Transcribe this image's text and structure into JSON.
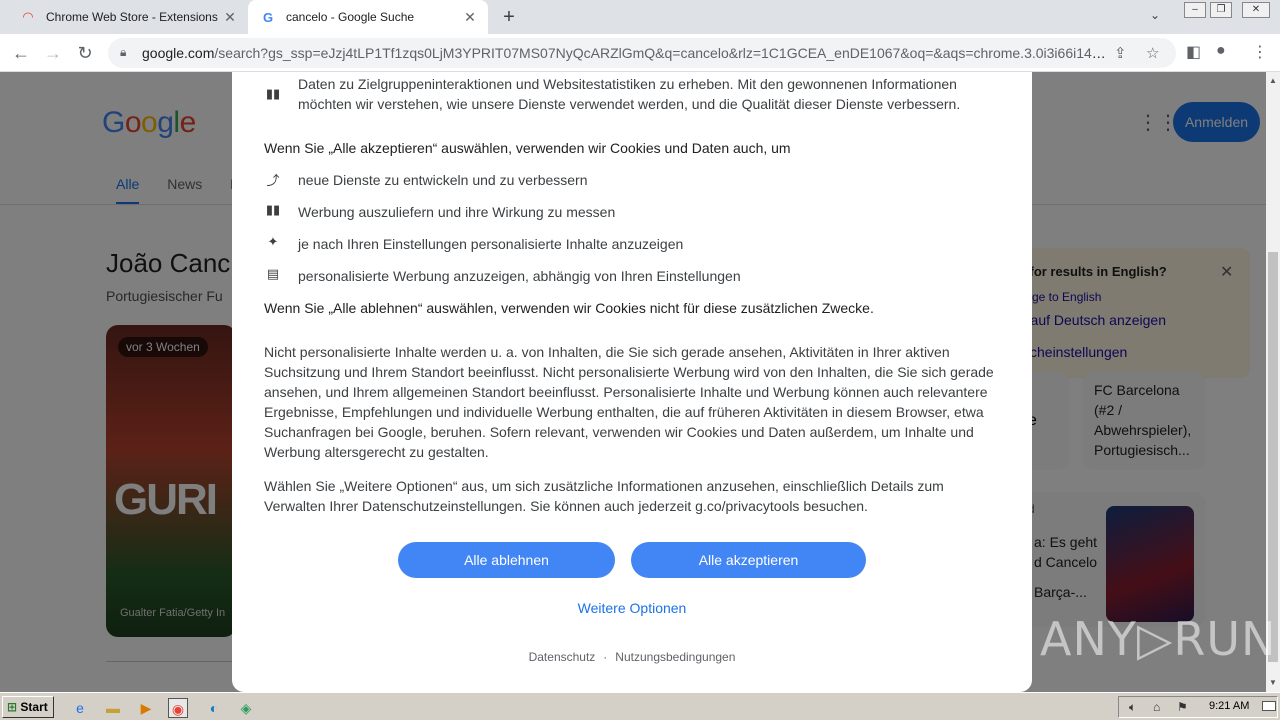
{
  "browser": {
    "tabs": [
      {
        "title": "Chrome Web Store - Extensions",
        "icon": "chrome-web-store-icon",
        "active": false
      },
      {
        "title": "cancelo - Google Suche",
        "icon": "google-g-icon",
        "active": true
      }
    ],
    "address": {
      "host": "google.com",
      "path": "/search?gs_ssp=eJzj4tLP1Tf1zqs0LjM3YPRIT07MS07NyQcARZlGmQ&q=cancelo&rlz=1C1GCEA_enDE1067&oq=&aqs=chrome.3.0i3i66i143i362..."
    }
  },
  "google_page": {
    "logo_letters": [
      "G",
      "o",
      "o",
      "g",
      "l",
      "e"
    ],
    "signin_label": "Anmelden",
    "tabs": [
      "Alle",
      "News",
      "Bi"
    ],
    "kp_title": "João Canc",
    "kp_subtitle": "Portugiesischer Fu",
    "hero_badge": "vor 3 Wochen",
    "hero_credit": "Gualter Fatia/Getty In",
    "hero_banner": "GURI",
    "english_box": {
      "question": "ng for results in English?",
      "link1": "ge to English",
      "link2": "r auf Deutsch anzeigen",
      "link3": "cheinstellungen"
    },
    "card0_text": "e",
    "card1_lines": [
      "FC Barcelona",
      "(#2 /",
      "Abwehrspieler),",
      "Portugiesisch..."
    ],
    "news_lines": [
      "a: Es geht",
      "d Cancelo",
      "Barça-..."
    ],
    "news_date": "d",
    "news_source": "n"
  },
  "consent": {
    "top_line1": "Daten zu Zielgruppeninteraktionen und Websitestatistiken zu erheben. Mit den gewonnenen Informationen",
    "top_line2": "möchten wir verstehen, wie unsere Dienste verwendet werden, und die Qualität dieser Dienste verbessern.",
    "accept_heading": "Wenn Sie „Alle akzeptieren“ auswählen, verwenden wir Cookies und Daten auch, um",
    "accept_items": [
      {
        "icon": "trending-icon",
        "text": "neue Dienste zu entwickeln und zu verbessern"
      },
      {
        "icon": "bar-chart-icon",
        "text": "Werbung auszuliefern und ihre Wirkung zu messen"
      },
      {
        "icon": "sparkle-icon",
        "text": "je nach Ihren Einstellungen personalisierte Inhalte anzuzeigen"
      },
      {
        "icon": "ad-icon",
        "text": "personalisierte Werbung anzuzeigen, abhängig von Ihren Einstellungen"
      }
    ],
    "reject_heading": "Wenn Sie „Alle ablehnen“ auswählen, verwenden wir Cookies nicht für diese zusätzlichen Zwecke.",
    "paragraph1": "Nicht personalisierte Inhalte werden u. a. von Inhalten, die Sie sich gerade ansehen, Aktivitäten in Ihrer aktiven Suchsitzung und Ihrem Standort beeinflusst. Nicht personalisierte Werbung wird von den Inhalten, die Sie sich gerade ansehen, und Ihrem allgemeinen Standort beeinflusst. Personalisierte Inhalte und Werbung können auch relevantere Ergebnisse, Empfehlungen und individuelle Werbung enthalten, die auf früheren Aktivitäten in diesem Browser, etwa Suchanfragen bei Google, beruhen. Sofern relevant, verwenden wir Cookies und Daten außerdem, um Inhalte und Werbung altersgerecht zu gestalten.",
    "paragraph2": "Wählen Sie „Weitere Optionen“ aus, um sich zusätzliche Informationen anzusehen, einschließlich Details zum Verwalten Ihrer Datenschutzeinstellungen. Sie können auch jederzeit g.co/privacytools besuchen.",
    "reject_button": "Alle ablehnen",
    "accept_button": "Alle akzeptieren",
    "more_options": "Weitere Optionen",
    "footer_privacy": "Datenschutz",
    "footer_separator": "·",
    "footer_terms": "Nutzungsbedingungen"
  },
  "watermark": "ANY▷RUN",
  "taskbar": {
    "start_label": "Start",
    "clock": "9:21 AM"
  },
  "colors": {
    "button_blue": "#4285f4",
    "link_blue": "#1a73e8",
    "signin_blue": "#1a73e8"
  }
}
